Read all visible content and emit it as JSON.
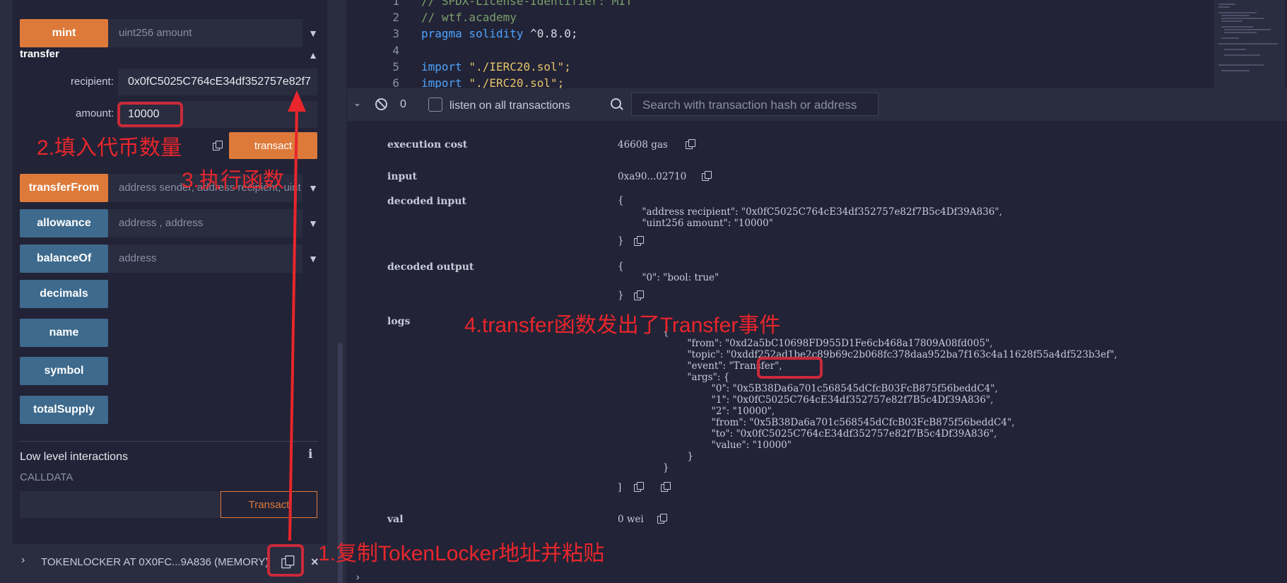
{
  "left_panel": {
    "mint": {
      "label": "mint",
      "placeholder": "uint256 amount"
    },
    "transfer": {
      "title": "transfer",
      "recipient_label": "recipient:",
      "recipient_value": "0x0fC5025C764cE34df352757e82f7",
      "amount_label": "amount:",
      "amount_value": "10000",
      "transact_label": "transact"
    },
    "transferFrom": {
      "label": "transferFrom",
      "placeholder": "address sender, address recipient, uint"
    },
    "allowance": {
      "label": "allowance",
      "placeholder": "address , address"
    },
    "balanceOf": {
      "label": "balanceOf",
      "placeholder": "address"
    },
    "decimals": {
      "label": "decimals"
    },
    "name": {
      "label": "name"
    },
    "symbol": {
      "label": "symbol"
    },
    "totalSupply": {
      "label": "totalSupply"
    },
    "low_level": {
      "title": "Low level interactions",
      "calldata": "CALLDATA",
      "transact_label": "Transact"
    },
    "contract_item": {
      "label": "TOKENLOCKER AT 0X0FC...9A836 (MEMORY)"
    }
  },
  "editor": {
    "lines": [
      {
        "n": "1",
        "text": "// SPDX-License-Identifier: MIT"
      },
      {
        "n": "2",
        "text": "// wtf.academy"
      },
      {
        "n": "3",
        "kw": "pragma solidity",
        "rest": " ^0.8.0;"
      },
      {
        "n": "4",
        "text": ""
      },
      {
        "n": "5",
        "kw": "import",
        "str": " \"./IERC20.sol\";"
      },
      {
        "n": "6",
        "kw": "import",
        "str": " \"./ERC20.sol\";"
      }
    ]
  },
  "terminal_bar": {
    "count": "0",
    "listen_label": "listen on all transactions",
    "search_placeholder": "Search with transaction hash or address"
  },
  "receipt": {
    "execution_cost_label": "execution cost",
    "execution_cost_value": "46608 gas",
    "input_label": "input",
    "input_value": "0xa90...02710",
    "decoded_input_label": "decoded input",
    "decoded_input_lines": [
      "{",
      "        \"address recipient\": \"0x0fC5025C764cE34df352757e82f7B5c4Df39A836\",",
      "        \"uint256 amount\": \"10000\""
    ],
    "decoded_input_close": "}",
    "decoded_output_label": "decoded output",
    "decoded_output_lines": [
      "{",
      "        \"0\": \"bool: true\""
    ],
    "decoded_output_close": "}",
    "logs_label": "logs",
    "logs_lines": [
      "{",
      "        \"from\": \"0xd2a5bC10698FD955D1Fe6cb468a17809A08fd005\",",
      "        \"topic\": \"0xddf252ad1be2c89b69c2b068fc378daa952ba7f163c4a11628f55a4df523b3ef\",",
      "        \"event\": \"Transfer\",",
      "        \"args\": {",
      "                \"0\": \"0x5B38Da6a701c568545dCfcB03FcB875f56beddC4\",",
      "                \"1\": \"0x0fC5025C764cE34df352757e82f7B5c4Df39A836\",",
      "                \"2\": \"10000\",",
      "                \"from\": \"0x5B38Da6a701c568545dCfcB03FcB875f56beddC4\",",
      "                \"to\": \"0x0fC5025C764cE34df352757e82f7B5c4Df39A836\",",
      "                \"value\": \"10000\"",
      "        }",
      "}"
    ],
    "logs_close": "]",
    "val_label": "val",
    "val_value": "0 wei"
  },
  "annotations": {
    "step1": "1.复制TokenLocker地址并粘贴",
    "step2": "2.填入代币数量",
    "step3": "3.执行函数",
    "step4": "4.transfer函数发出了Transfer事件"
  },
  "colors": {
    "orange": "#dd7a3a",
    "blue": "#3d6a8d",
    "annotation": "#e8262c",
    "background": "#222336"
  }
}
